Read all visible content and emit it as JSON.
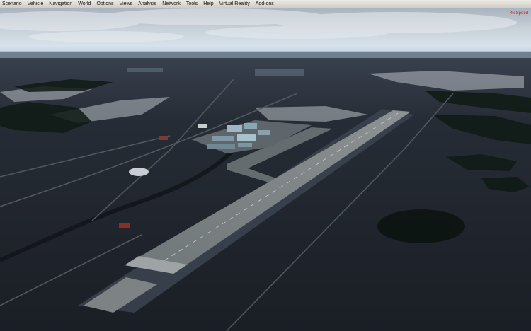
{
  "menubar": {
    "items": [
      {
        "label": "Scenario"
      },
      {
        "label": "Vehicle"
      },
      {
        "label": "Navigation"
      },
      {
        "label": "World"
      },
      {
        "label": "Options"
      },
      {
        "label": "Views"
      },
      {
        "label": "Analysis"
      },
      {
        "label": "Network"
      },
      {
        "label": "Tools"
      },
      {
        "label": "Help"
      },
      {
        "label": "Virtual Reality"
      },
      {
        "label": "Add-ons"
      }
    ]
  },
  "sim_status": {
    "speed_label": "4x Speed",
    "speed_color": "#e01010"
  },
  "colors": {
    "menubar_bg": "#dcdad3",
    "sky_top": "#b9c2cc",
    "horizon": "#c8d8e6",
    "ground": "#1d222a"
  }
}
